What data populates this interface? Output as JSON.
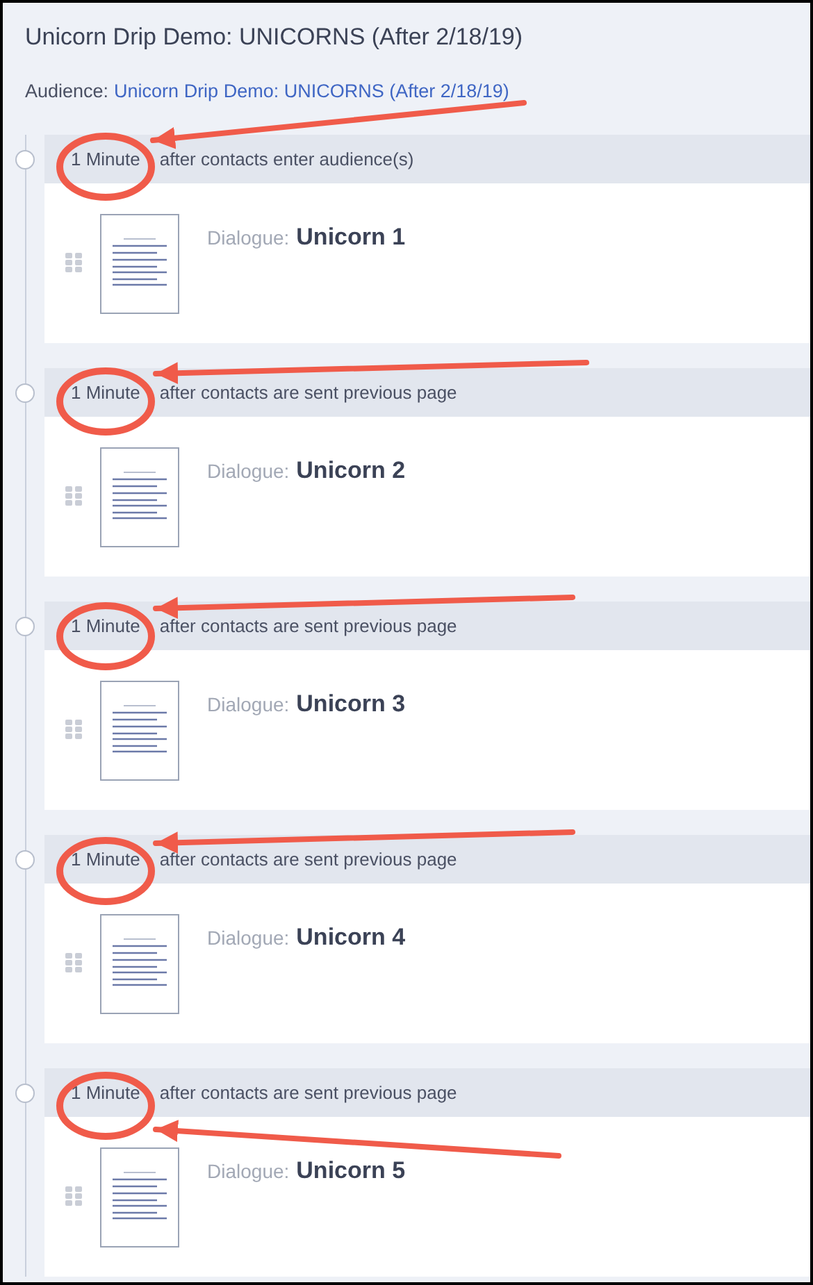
{
  "title": "Unicorn Drip Demo: UNICORNS (After 2/18/19)",
  "audience": {
    "label": "Audience:",
    "link": "Unicorn Drip Demo: UNICORNS (After 2/18/19)"
  },
  "steps": [
    {
      "delay": "1 Minute",
      "trigger": "after contacts enter audience(s)",
      "type_label": "Dialogue:",
      "name": "Unicorn 1"
    },
    {
      "delay": "1 Minute",
      "trigger": "after contacts are sent previous page",
      "type_label": "Dialogue:",
      "name": "Unicorn 2"
    },
    {
      "delay": "1 Minute",
      "trigger": "after contacts are sent previous page",
      "type_label": "Dialogue:",
      "name": "Unicorn 3"
    },
    {
      "delay": "1 Minute",
      "trigger": "after contacts are sent previous page",
      "type_label": "Dialogue:",
      "name": "Unicorn 4"
    },
    {
      "delay": "1 Minute",
      "trigger": "after contacts are sent previous page",
      "type_label": "Dialogue:",
      "name": "Unicorn 5"
    }
  ]
}
